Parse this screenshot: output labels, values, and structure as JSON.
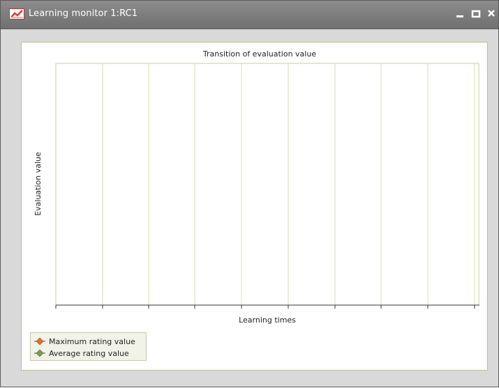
{
  "window": {
    "title": "Learning monitor 1:RC1",
    "minimize_label": "–",
    "maximize_label": "□",
    "close_label": "×",
    "icon": "chart-icon"
  },
  "chart_data": {
    "type": "line",
    "title": "Transition of evaluation value",
    "xlabel": "Learning times",
    "ylabel": "Evaluation value",
    "grid": true,
    "legend_placement": "bottom-left",
    "series": [
      {
        "name": "Maximum rating value",
        "color": "#e07030",
        "values": []
      },
      {
        "name": "Average rating value",
        "color": "#7d9a4e",
        "values": []
      }
    ]
  }
}
